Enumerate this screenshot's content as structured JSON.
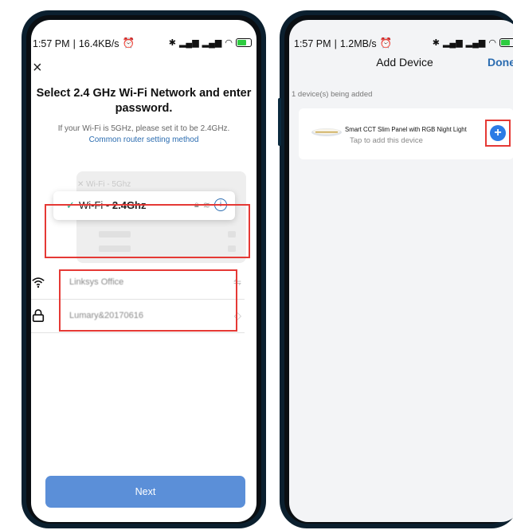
{
  "left_screen": {
    "status_bar": {
      "time": "1:57 PM",
      "separator": "|",
      "net_speed": "16.4KB/s"
    },
    "close_glyph": "×",
    "heading": "Select 2.4 GHz Wi-Fi Network and enter password.",
    "hint": "If your Wi-Fi is 5GHz, please set it to be 2.4GHz.",
    "hint_link": "Common router setting method",
    "illustration": {
      "ghost_network": "Wi-Fi - 5Ghz",
      "selected_prefix": "Wi-Fi - ",
      "selected_band": "2.4Ghz",
      "info_glyph": "i"
    },
    "network_field": {
      "value": "Linksys Office",
      "icon": "wifi-icon",
      "trailing_icon": "switch-network-icon"
    },
    "password_field": {
      "value": "Lumary&20170616",
      "icon": "lock-icon",
      "trailing_icon": "eye-icon"
    },
    "next_button": "Next"
  },
  "right_screen": {
    "status_bar": {
      "time": "1:57 PM",
      "separator": "|",
      "net_speed": "1.2MB/s"
    },
    "title": "Add Device",
    "done_button": "Done",
    "devices_status": "1 device(s) being added",
    "device": {
      "name": "Smart CCT Slim Panel with RGB Night Light",
      "subtitle": "Tap to add this device"
    }
  },
  "colors": {
    "accent": "#2c7be5",
    "primary_button": "#5b8fd8",
    "annotation_red": "#e53935",
    "check_green": "#2ca88a"
  }
}
